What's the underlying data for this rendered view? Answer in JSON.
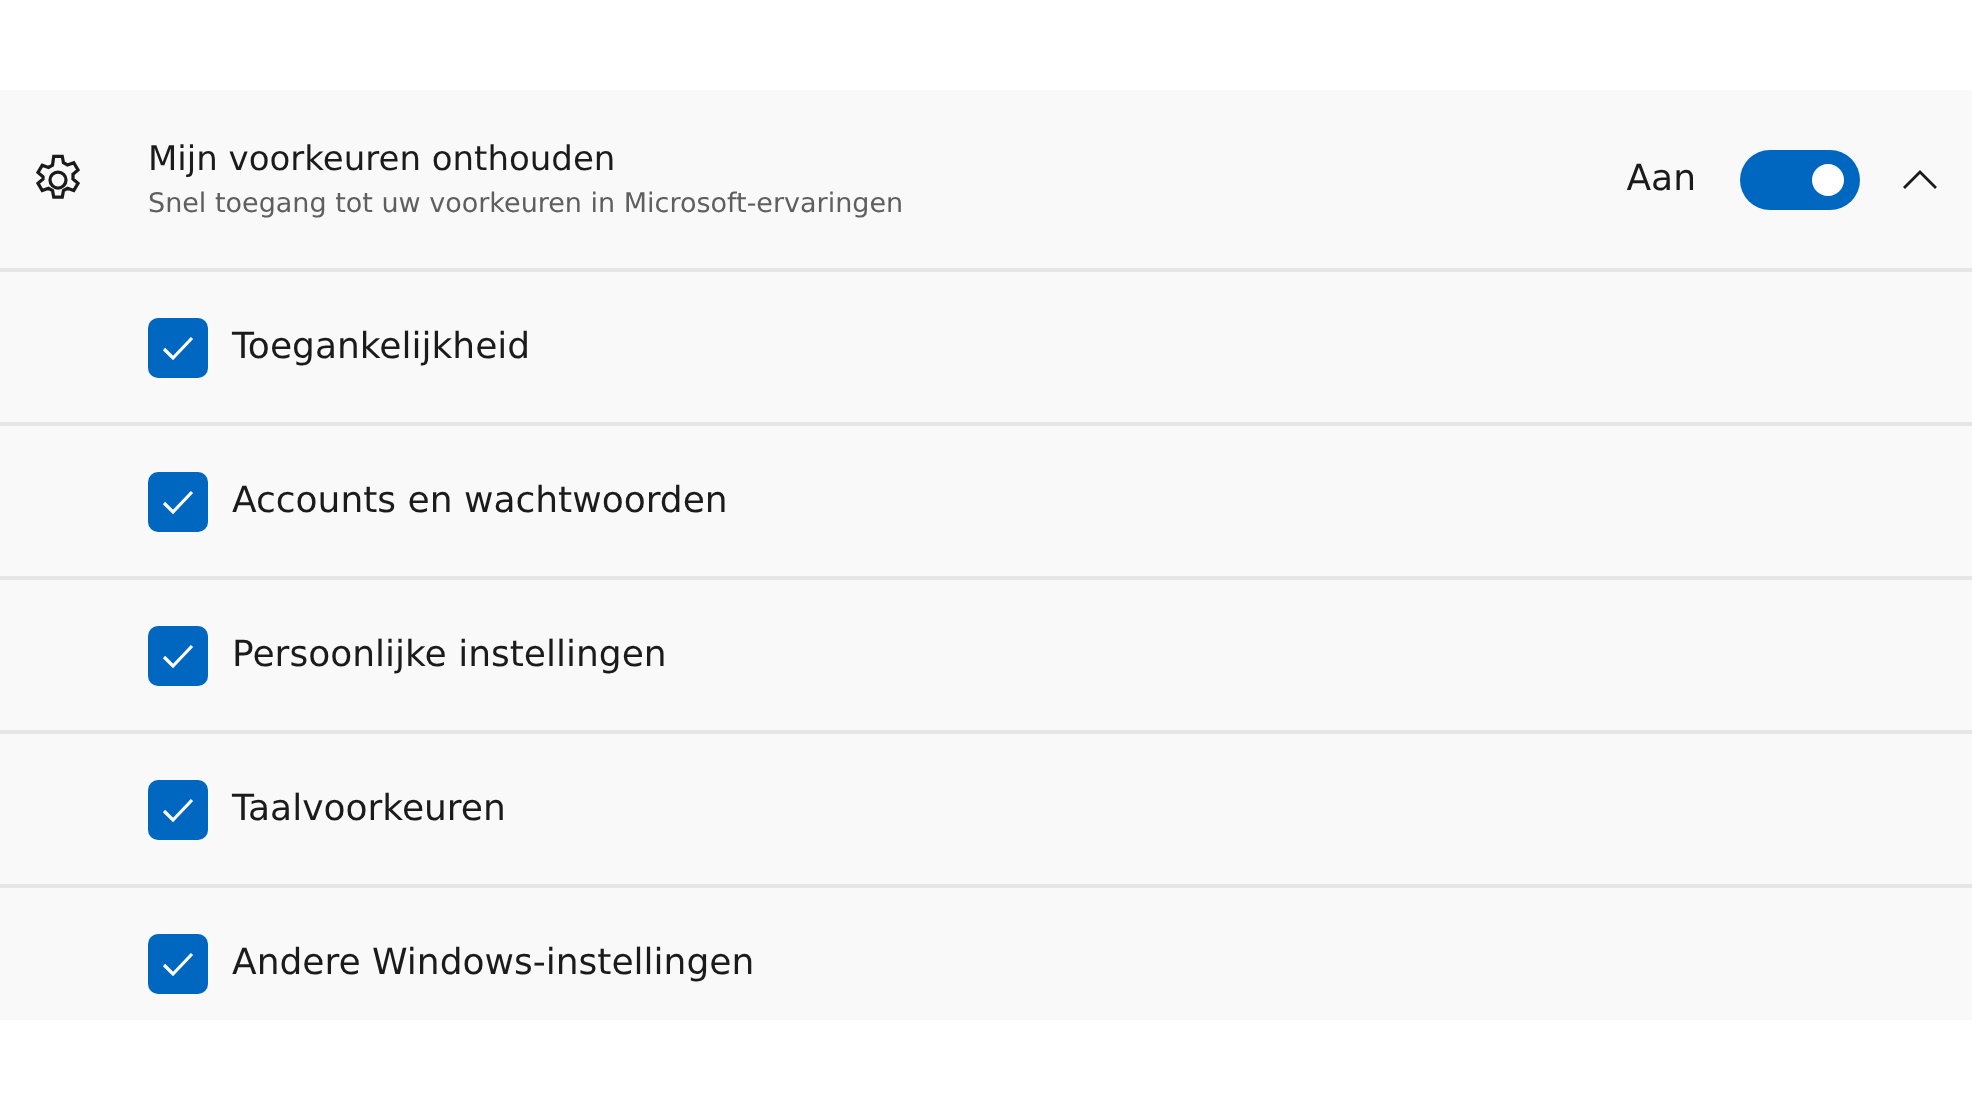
{
  "setting": {
    "title": "Mijn voorkeuren onthouden",
    "description": "Snel toegang tot uw voorkeuren in Microsoft-ervaringen",
    "toggle_label": "Aan",
    "on": true,
    "expanded": true
  },
  "options": [
    {
      "label": "Toegankelijkheid",
      "checked": true
    },
    {
      "label": "Accounts en wachtwoorden",
      "checked": true
    },
    {
      "label": "Persoonlijke instellingen",
      "checked": true
    },
    {
      "label": "Taalvoorkeuren",
      "checked": true
    },
    {
      "label": "Andere Windows-instellingen",
      "checked": true
    }
  ]
}
